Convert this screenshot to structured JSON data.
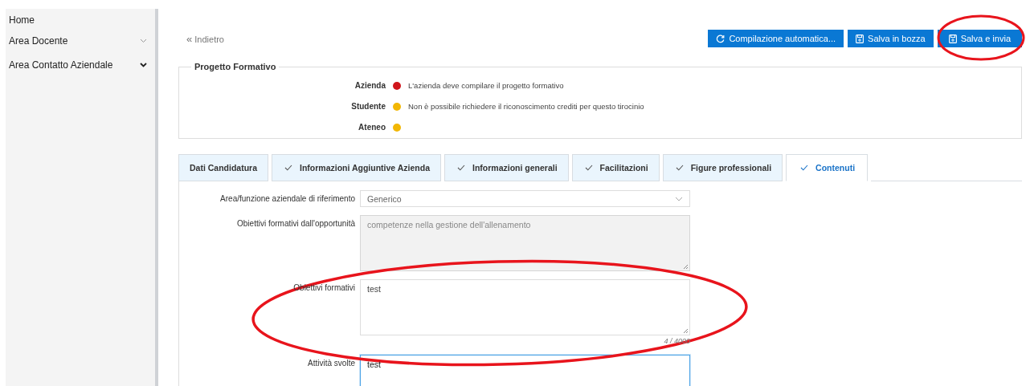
{
  "sidebar": {
    "items": [
      {
        "label": "Home"
      },
      {
        "label": "Area Docente",
        "expandable": true,
        "expanded": false
      },
      {
        "label": "Area Contatto Aziendale",
        "expandable": true,
        "expanded": true
      }
    ]
  },
  "back_link": {
    "icon": "«",
    "label": "Indietro"
  },
  "toolbar": {
    "buttons": [
      {
        "kind": "refresh",
        "label": "Compilazione automatica..."
      },
      {
        "kind": "save",
        "label": "Salva in bozza"
      },
      {
        "kind": "save",
        "label": "Salva e invia"
      }
    ]
  },
  "status_panel": {
    "title": "Progetto Formativo",
    "rows": [
      {
        "label": "Azienda",
        "color": "#d0161c",
        "message": "L'azienda deve compilare il progetto formativo"
      },
      {
        "label": "Studente",
        "color": "#f2b705",
        "message": "Non è possibile richiedere il riconoscimento crediti per questo tirocinio"
      },
      {
        "label": "Ateneo",
        "color": "#f2b705"
      }
    ]
  },
  "tabs": [
    {
      "label": "Dati Candidatura",
      "checked": false,
      "selected": false
    },
    {
      "label": "Informazioni Aggiuntive Azienda",
      "checked": true,
      "selected": false
    },
    {
      "label": "Informazioni generali",
      "checked": true,
      "selected": false
    },
    {
      "label": "Facilitazioni",
      "checked": true,
      "selected": false
    },
    {
      "label": "Figure professionali",
      "checked": true,
      "selected": false
    },
    {
      "label": "Contenuti",
      "checked": true,
      "selected": true
    }
  ],
  "form": {
    "fields": [
      {
        "kind": "select",
        "label": "Area/funzione aziendale di riferimento",
        "value": "Generico"
      },
      {
        "kind": "textarea",
        "label": "Obiettivi formativi dall'opportunità",
        "value": "competenze nella gestione dell'allenamento",
        "disabled": true,
        "focused": false
      },
      {
        "kind": "textarea",
        "label": "Obiettivi formativi",
        "value": "test",
        "disabled": false,
        "focused": false,
        "counter": "4 / 4000"
      },
      {
        "kind": "textarea",
        "label": "Attività svolte",
        "value": "test",
        "disabled": false,
        "focused": true
      }
    ]
  }
}
